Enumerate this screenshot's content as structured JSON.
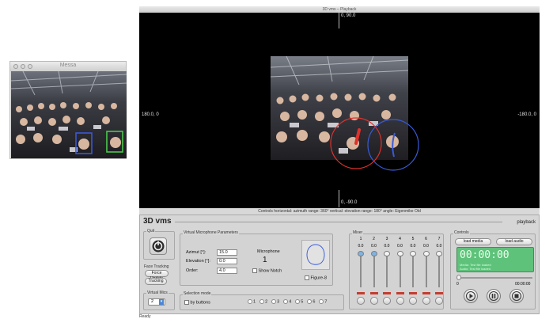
{
  "messa": {
    "title": "Messa",
    "detections": [
      {
        "color": "#3b57d6",
        "label": "face-detection-blue"
      },
      {
        "color": "#49c94b",
        "label": "face-detection-green"
      }
    ]
  },
  "playback": {
    "title": "3D vms – Playback",
    "axes": {
      "top": "0, 90.0",
      "bottom": "0, -90.0",
      "left": "180.0, 0",
      "right": "-180.0, 0"
    },
    "status": "Controls    horizontal: azimuth range: 360°   vertical: elevation range: 180°   angle: Eigenmike Old",
    "circles": [
      {
        "name": "red-mic",
        "color": "#e0312b"
      },
      {
        "name": "blue-mic",
        "color": "#3a5bd8"
      }
    ]
  },
  "vms": {
    "title": "3D vms",
    "mode": "playback",
    "quit": {
      "title": "Quit"
    },
    "face_tracking": {
      "title": "Face Tracking",
      "update_btn": "Force Update",
      "tracking_btn": "Tracking"
    },
    "virtual_mics": {
      "title": "Virtual Mics",
      "value": "2"
    },
    "params": {
      "title": "Virtual Microphone Parameters",
      "azimut_label": "Azimut [°]:",
      "azimut": "15.0",
      "elevation_label": "Elevation [°]:",
      "elevation": "0.0",
      "order_label": "Order:",
      "order": "4.0",
      "mic_label": "Microphone",
      "mic_number": "1",
      "show_notch": "Show Notch",
      "figure8": "Figure-8"
    },
    "selection": {
      "title": "Selection mode",
      "by_buttons": "by buttons",
      "options": [
        "1",
        "2",
        "3",
        "4",
        "5",
        "6",
        "7"
      ]
    },
    "mixer": {
      "title": "Mixer",
      "channels": [
        "1",
        "2",
        "3",
        "4",
        "5",
        "6",
        "7"
      ],
      "values": [
        "0.0",
        "0.0",
        "0.0",
        "0.0",
        "0.0",
        "0.0",
        "0.0"
      ]
    },
    "controls": {
      "title": "Controls",
      "load_media": "load media",
      "load_audio": "load audio",
      "time": "00:00:00",
      "lcd_line1": "Media: Test file loaded",
      "lcd_line2": "Audio: Test file loaded",
      "pos_start": "0",
      "pos_end": "00:00:00"
    }
  },
  "status_text": "Ready",
  "colors": {
    "lcd": "#5ec27b",
    "lcd_text": "#eaffea",
    "slider_knob": "#7fb3e3",
    "accent_red": "#c43d2f"
  }
}
